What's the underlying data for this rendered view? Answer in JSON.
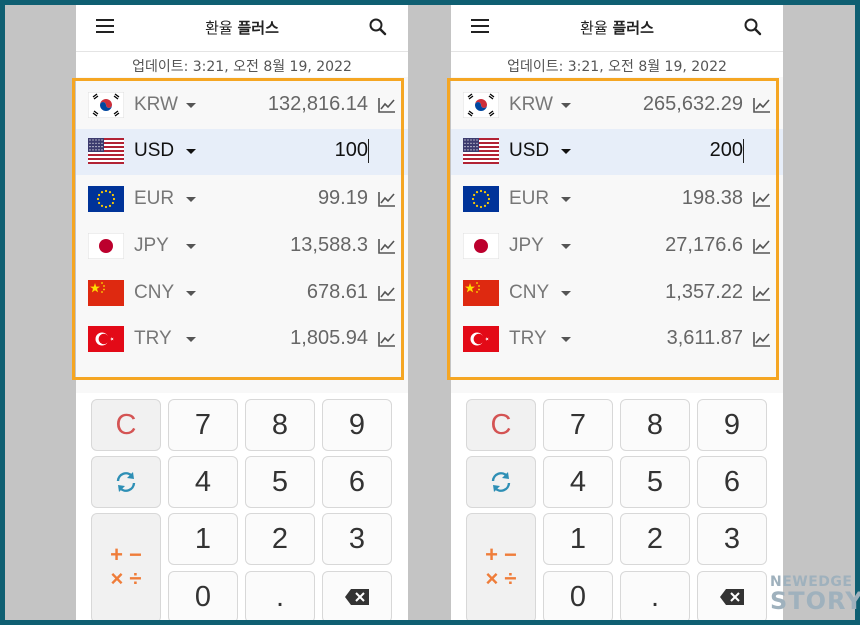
{
  "app": {
    "title_part1": "환율",
    "title_part2": "플러스"
  },
  "update_text": "업데이트: 3:21, 오전 8월 19, 2022",
  "colors": {
    "highlight": "#f5a623",
    "active_row": "#e7eef9",
    "clear_key": "#d45454",
    "refresh_icon": "#2e8fb5",
    "ops_icon": "#ef7d3a"
  },
  "screens": [
    {
      "rows": [
        {
          "code": "KRW",
          "amount": "132,816.14",
          "flag": "kr-flag"
        },
        {
          "code": "USD",
          "amount": "100",
          "flag": "us-flag"
        },
        {
          "code": "EUR",
          "amount": "99.19",
          "flag": "eu-flag"
        },
        {
          "code": "JPY",
          "amount": "13,588.3",
          "flag": "jp-flag"
        },
        {
          "code": "CNY",
          "amount": "678.61",
          "flag": "cn-flag"
        },
        {
          "code": "TRY",
          "amount": "1,805.94",
          "flag": "tr-flag"
        }
      ]
    },
    {
      "rows": [
        {
          "code": "KRW",
          "amount": "265,632.29",
          "flag": "kr-flag"
        },
        {
          "code": "USD",
          "amount": "200",
          "flag": "us-flag"
        },
        {
          "code": "EUR",
          "amount": "198.38",
          "flag": "eu-flag"
        },
        {
          "code": "JPY",
          "amount": "27,176.6",
          "flag": "jp-flag"
        },
        {
          "code": "CNY",
          "amount": "1,357.22",
          "flag": "cn-flag"
        },
        {
          "code": "TRY",
          "amount": "3,611.87",
          "flag": "tr-flag"
        }
      ]
    }
  ],
  "keypad": {
    "clear": "C",
    "k7": "7",
    "k8": "8",
    "k9": "9",
    "k4": "4",
    "k5": "5",
    "k6": "6",
    "k1": "1",
    "k2": "2",
    "k3": "3",
    "k0": "0",
    "dot": ".",
    "ops_top": "+ −",
    "ops_bottom": "× ÷",
    "refresh_icon": "refresh-icon",
    "backspace_icon": "backspace-icon"
  },
  "watermark": {
    "line1": "NEWEDGE",
    "line2": "STORY"
  }
}
